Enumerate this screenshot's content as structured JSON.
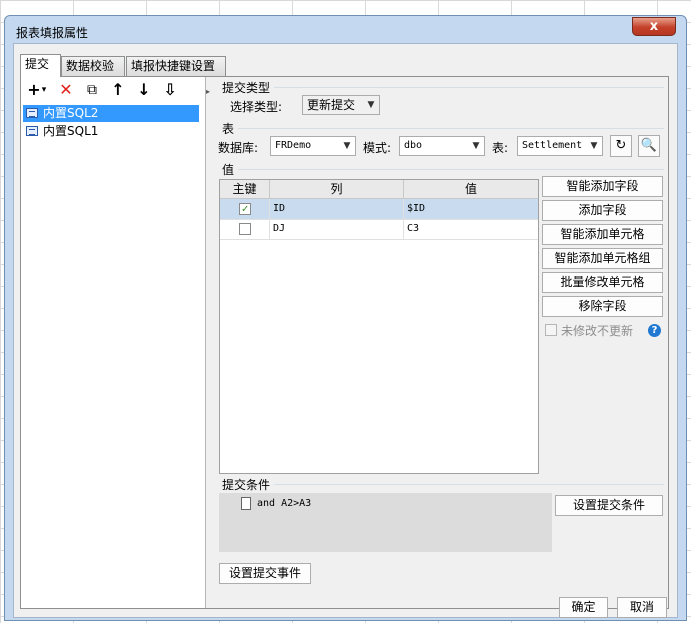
{
  "window": {
    "title": "报表填报属性",
    "close_label": "x"
  },
  "tabs": [
    {
      "label": "提交",
      "active": true
    },
    {
      "label": "数据校验",
      "active": false
    },
    {
      "label": "填报快捷键设置",
      "active": false
    }
  ],
  "toolbar": {
    "add_icon": "+",
    "add_dropdown": "▾",
    "delete_icon": "✕",
    "copy_icon": "⧉",
    "up_icon": "↑",
    "down_icon": "↓",
    "sort_icon": "⇩"
  },
  "tree": {
    "items": [
      {
        "label": "内置SQL2",
        "selected": true
      },
      {
        "label": "内置SQL1",
        "selected": false
      }
    ]
  },
  "submit_type": {
    "section_label": "提交类型",
    "select_label": "选择类型:",
    "selected_value": "更新提交"
  },
  "table_section": {
    "section_label": "表",
    "database_label": "数据库:",
    "database_value": "FRDemo",
    "schema_label": "模式:",
    "schema_value": "dbo",
    "table_label": "表:",
    "table_value": "Settlement"
  },
  "value_section": {
    "section_label": "值",
    "columns": [
      "主键",
      "列",
      "值"
    ],
    "rows": [
      {
        "key": true,
        "column": "ID",
        "value": "$ID",
        "selected": true
      },
      {
        "key": false,
        "column": "DJ",
        "value": "C3",
        "selected": false
      }
    ]
  },
  "side_buttons": [
    "智能添加字段",
    "添加字段",
    "智能添加单元格",
    "智能添加单元格组",
    "批量修改单元格",
    "移除字段"
  ],
  "no_update_unchanged": {
    "label": "未修改不更新",
    "checked": false
  },
  "help_icon": "?",
  "submit_condition": {
    "section_label": "提交条件",
    "condition_text": "and A2>A3",
    "set_button": "设置提交条件"
  },
  "set_event_button": "设置提交事件",
  "footer": {
    "ok": "确定",
    "cancel": "取消"
  },
  "colors": {
    "dialog_frame": "#c4d9ef",
    "selection": "#3399ff",
    "close_button": "#c4402a"
  }
}
